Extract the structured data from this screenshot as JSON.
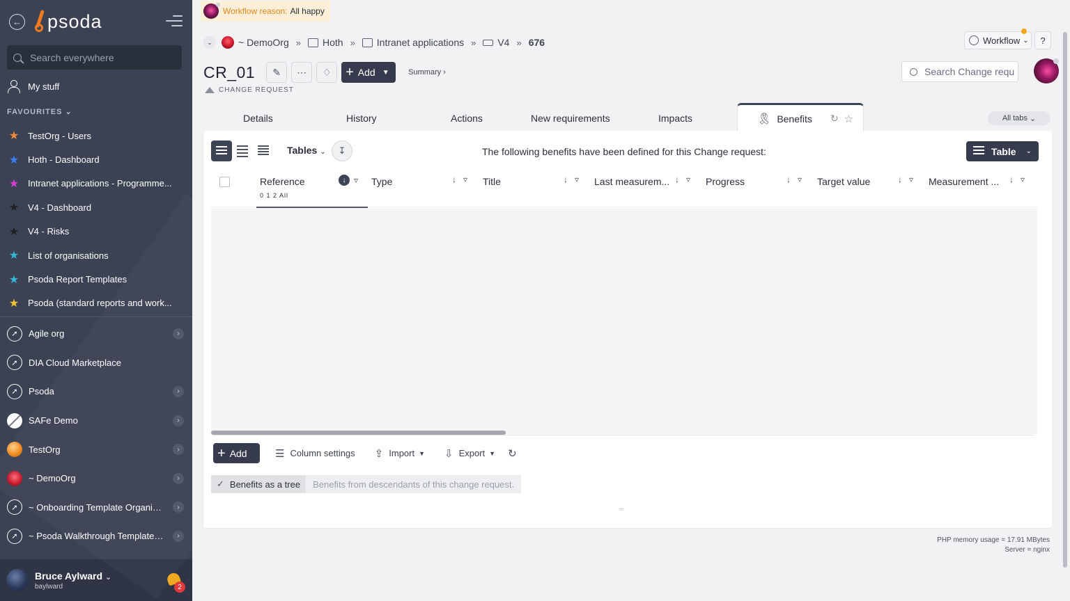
{
  "sidebar": {
    "logo_text": "psoda",
    "search_placeholder": "Search everywhere",
    "my_stuff": "My stuff",
    "favourites_title": "FAVOURITES",
    "favourites": [
      {
        "label": "TestOrg - Users",
        "star_color": "#f28c3c"
      },
      {
        "label": "Hoth - Dashboard",
        "star_color": "#3b82f6"
      },
      {
        "label": "Intranet applications - Programme...",
        "star_color": "#d23fd1"
      },
      {
        "label": "V4 - Dashboard",
        "star_color": "#1f1f1f"
      },
      {
        "label": "V4 - Risks",
        "star_color": "#1f1f1f"
      },
      {
        "label": "List of organisations",
        "star_color": "#35b8d8"
      },
      {
        "label": "Psoda Report Templates",
        "star_color": "#35b8d8"
      },
      {
        "label": "Psoda (standard reports and work...",
        "star_color": "#f2c230"
      }
    ],
    "organisations": [
      {
        "label": "Agile org",
        "icon": "rocket-icon",
        "has_chevron": true
      },
      {
        "label": "DIA Cloud Marketplace",
        "icon": "rocket-icon",
        "has_chevron": false
      },
      {
        "label": "Psoda",
        "icon": "rocket-icon",
        "has_chevron": true
      },
      {
        "label": "SAFe Demo",
        "icon": "safe-logo",
        "has_chevron": true
      },
      {
        "label": "TestOrg",
        "icon": "orange-orb",
        "has_chevron": true
      },
      {
        "label": "~ DemoOrg",
        "icon": "red-flower",
        "has_chevron": true
      },
      {
        "label": "~ Onboarding Template Organisa...",
        "icon": "rocket-icon",
        "has_chevron": true
      },
      {
        "label": "~ Psoda Walkthrough Template P...",
        "icon": "rocket-icon",
        "has_chevron": true
      }
    ],
    "user": {
      "name": "Bruce Aylward",
      "login": "baylward",
      "notification_count": "2"
    }
  },
  "header": {
    "workflow_reason_label": "Workflow reason:",
    "workflow_reason_value": "All happy",
    "breadcrumb": [
      "~ DemoOrg",
      "Hoth",
      "Intranet applications",
      "V4",
      "676"
    ],
    "workflow_button": "Workflow",
    "help_button": "?",
    "title": "CR_01",
    "add_button": "Add",
    "summary_link": "Summary ›",
    "subtitle": "CHANGE REQUEST",
    "search_placeholder": "Search Change requ"
  },
  "tabs": {
    "items": [
      "Details",
      "History",
      "Actions",
      "New requirements",
      "Impacts"
    ],
    "active": "Benefits",
    "all_tabs": "All tabs"
  },
  "panel": {
    "tables_dropdown": "Tables",
    "message": "The following benefits have been defined for this Change request:",
    "table_button": "Table",
    "columns": [
      "Reference",
      "Type",
      "Title",
      "Last measurem...",
      "Progress",
      "Target value",
      "Measurement ..."
    ],
    "reference_levels": "0 1 2 All",
    "actions": {
      "add": "Add",
      "column_settings": "Column settings",
      "import": "Import",
      "export": "Export"
    },
    "tree_option_label": "Benefits as a tree",
    "tree_option_desc": "Benefits from descendants of this change request."
  },
  "footer": {
    "memory": "PHP memory usage = 17.91 MBytes",
    "server": "Server = nginx"
  },
  "colors": {
    "sidebar_bg": "#3b4254",
    "accent_dark": "#363c4d",
    "brand_orange": "#f07b1f",
    "workflow_banner": "#fbefd8"
  }
}
